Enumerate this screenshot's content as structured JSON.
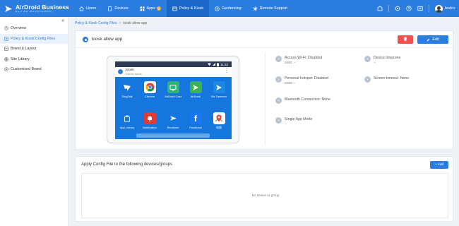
{
  "brand": {
    "title": "AirDroid Business",
    "subtitle": "DEVICE MANAGEMENT"
  },
  "nav": [
    {
      "label": "Home",
      "icon": "home-icon"
    },
    {
      "label": "Devices",
      "icon": "devices-icon"
    },
    {
      "label": "Apps",
      "icon": "apps-icon",
      "badge": "1"
    },
    {
      "label": "Policy & Kiosk",
      "icon": "policy-icon",
      "active": true
    },
    {
      "label": "Geofencing",
      "icon": "geofencing-icon"
    },
    {
      "label": "Remote Support",
      "icon": "remote-support-icon"
    }
  ],
  "user": {
    "name": "Andro"
  },
  "sidebar": {
    "collapse_glyph": "«",
    "items": [
      {
        "label": "Overview"
      },
      {
        "label": "Policy & Kiosk Config Files",
        "active": true
      },
      {
        "label": "Brand & Layout"
      },
      {
        "label": "Site Library"
      },
      {
        "label": "Customized Brand"
      }
    ]
  },
  "breadcrumb": {
    "parent": "Policy & Kiosk Config Files",
    "sep": ">",
    "current": "kiosk allow app"
  },
  "config": {
    "title": "kiosk allow app",
    "edit_label": "Edit",
    "device": {
      "time": "11:32",
      "app_title": "Kiosk",
      "app_subtitle": "Device Name",
      "apps": [
        {
          "label": "DingTalk",
          "icon": "dingtalk-icon"
        },
        {
          "label": "Chrome",
          "icon": "chrome-icon"
        },
        {
          "label": "AirDroid Cast",
          "icon": "airdroid-cast-icon"
        },
        {
          "label": "AirDroid",
          "icon": "airdroid-icon"
        },
        {
          "label": "Biz Daemon",
          "icon": "biz-daemon-icon"
        },
        {
          "label": "App Library",
          "icon": "app-library-icon"
        },
        {
          "label": "Notification",
          "icon": "notification-icon"
        },
        {
          "label": "Reviewer",
          "icon": "reviewer-icon"
        },
        {
          "label": "Facebook",
          "icon": "facebook-icon"
        },
        {
          "label": "地图",
          "icon": "maps-icon"
        }
      ]
    },
    "properties": [
      {
        "title": "Access Wi-Fi: Disabled",
        "sub": "SSID: --",
        "icon": "wifi-icon"
      },
      {
        "title": "Device timezone",
        "sub": "--",
        "icon": "clock-icon"
      },
      {
        "title": "Personal hotspot: Disabled",
        "sub": "SSID: --",
        "icon": "hotspot-icon"
      },
      {
        "title": "Screen timeout: None",
        "sub": "",
        "icon": "screen-timeout-icon"
      },
      {
        "title": "Bluetooth Connection: None",
        "sub": "",
        "icon": "bluetooth-icon"
      },
      {
        "title": "Single App Mode",
        "sub": "--",
        "icon": "single-app-icon"
      }
    ]
  },
  "apply": {
    "title": "Apply Config File to the following devices/groups",
    "add_label": "+ Add",
    "empty_text": "No device or group"
  },
  "colors": {
    "primary": "#2b7de0",
    "danger": "#ef5350",
    "grid": "#1576dd"
  }
}
